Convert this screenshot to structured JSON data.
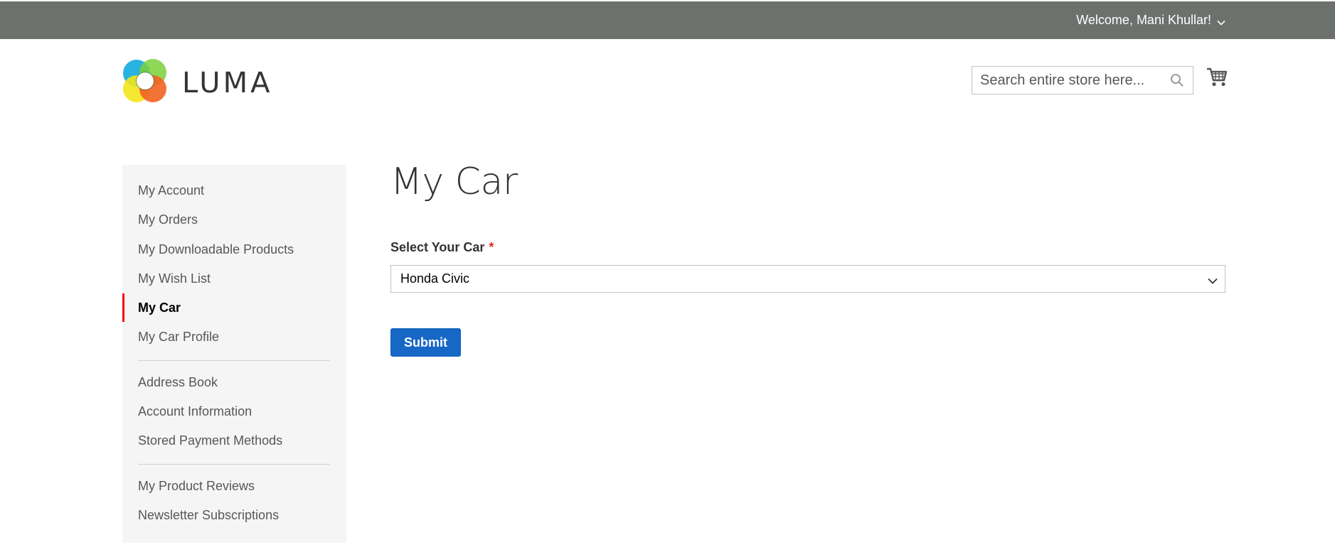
{
  "header": {
    "welcome_text": "Welcome, Mani Khullar!",
    "logo_text": "LUMA",
    "search_placeholder": "Search entire store here..."
  },
  "sidebar": {
    "items": [
      {
        "label": "My Account"
      },
      {
        "label": "My Orders"
      },
      {
        "label": "My Downloadable Products"
      },
      {
        "label": "My Wish List"
      },
      {
        "label": "My Car",
        "active": true
      },
      {
        "label": "My Car Profile"
      },
      {
        "label": "Address Book"
      },
      {
        "label": "Account Information"
      },
      {
        "label": "Stored Payment Methods"
      },
      {
        "label": "My Product Reviews"
      },
      {
        "label": "Newsletter Subscriptions"
      }
    ]
  },
  "main": {
    "title": "My Car",
    "field_label": "Select Your Car",
    "required_mark": "*",
    "selected_car": "Honda Civic",
    "submit_label": "Submit"
  },
  "colors": {
    "topbar": "#6d716e",
    "active_marker": "#ff0000",
    "button": "#1767c6",
    "required": "#e02b27"
  },
  "icons": [
    "chevron-down-icon",
    "search-icon",
    "cart-icon",
    "luma-logo-icon"
  ]
}
